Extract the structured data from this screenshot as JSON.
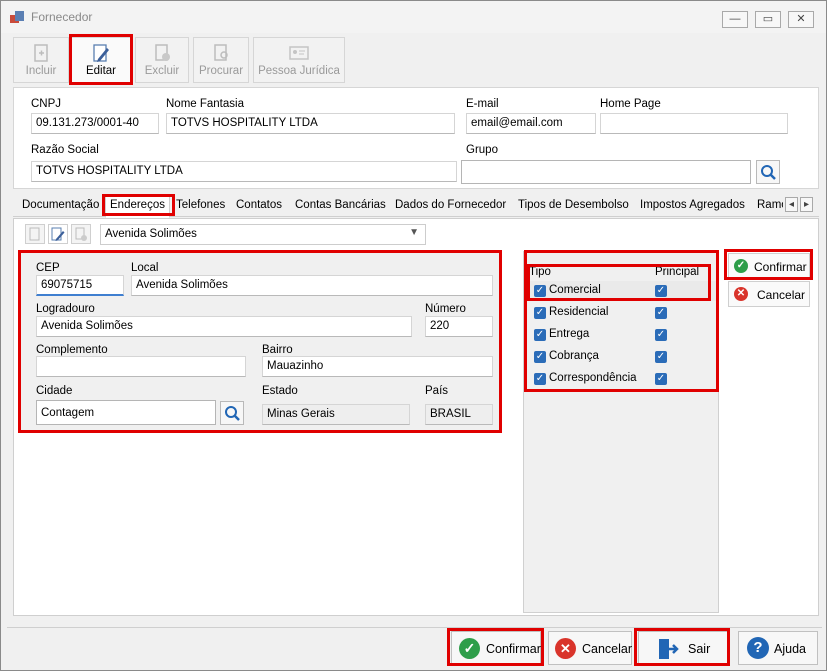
{
  "window": {
    "title": "Fornecedor",
    "min": "—",
    "max": "▭",
    "close": "✕"
  },
  "toolbar": {
    "incluir": "Incluir",
    "editar": "Editar",
    "excluir": "Excluir",
    "procurar": "Procurar",
    "pessoa_juridica": "Pessoa Jurídica"
  },
  "header": {
    "cnpj_label": "CNPJ",
    "cnpj_value": "09.131.273/0001-40",
    "nome_fantasia_label": "Nome Fantasia",
    "nome_fantasia_value": "TOTVS HOSPITALITY LTDA",
    "email_label": "E-mail",
    "email_value": "email@email.com",
    "homepage_label": "Home Page",
    "homepage_value": "",
    "razao_social_label": "Razão Social",
    "razao_social_value": "TOTVS HOSPITALITY LTDA",
    "grupo_label": "Grupo",
    "grupo_value": ""
  },
  "tabs": [
    "Documentação",
    "Endereços",
    "Telefones",
    "Contatos",
    "Contas Bancárias",
    "Dados do Fornecedor",
    "Tipos de Desembolso",
    "Impostos Agregados",
    "Ramo"
  ],
  "tab_scroll": {
    "left": "◂",
    "right": "▸"
  },
  "address_select": "Avenida Solimões",
  "address": {
    "cep_label": "CEP",
    "cep_value": "69075715",
    "local_label": "Local",
    "local_value": "Avenida Solimões",
    "logradouro_label": "Logradouro",
    "logradouro_value": "Avenida Solimões",
    "numero_label": "Número",
    "numero_value": "220",
    "complemento_label": "Complemento",
    "complemento_value": "",
    "bairro_label": "Bairro",
    "bairro_value": "Mauazinho",
    "cidade_label": "Cidade",
    "cidade_value": "Contagem",
    "estado_label": "Estado",
    "estado_value": "Minas Gerais",
    "pais_label": "País",
    "pais_value": "BRASIL"
  },
  "tipo_header": {
    "tipo": "Tipo",
    "principal": "Principal"
  },
  "tipos": [
    {
      "label": "Comercial",
      "checked": true,
      "principal": true
    },
    {
      "label": "Residencial",
      "checked": true,
      "principal": true
    },
    {
      "label": "Entrega",
      "checked": true,
      "principal": true
    },
    {
      "label": "Cobrança",
      "checked": true,
      "principal": true
    },
    {
      "label": "Correspondência",
      "checked": true,
      "principal": true
    }
  ],
  "side_buttons": {
    "confirmar": "Confirmar",
    "cancelar": "Cancelar"
  },
  "bottom_buttons": {
    "confirmar": "Confirmar",
    "cancelar": "Cancelar",
    "sair": "Sair",
    "ajuda": "Ajuda"
  },
  "colors": {
    "highlight": "#e00000",
    "check_blue": "#2b6cb8",
    "confirm_green": "#2e9e4a",
    "cancel_red": "#d9342b",
    "help_blue": "#2166b5"
  }
}
